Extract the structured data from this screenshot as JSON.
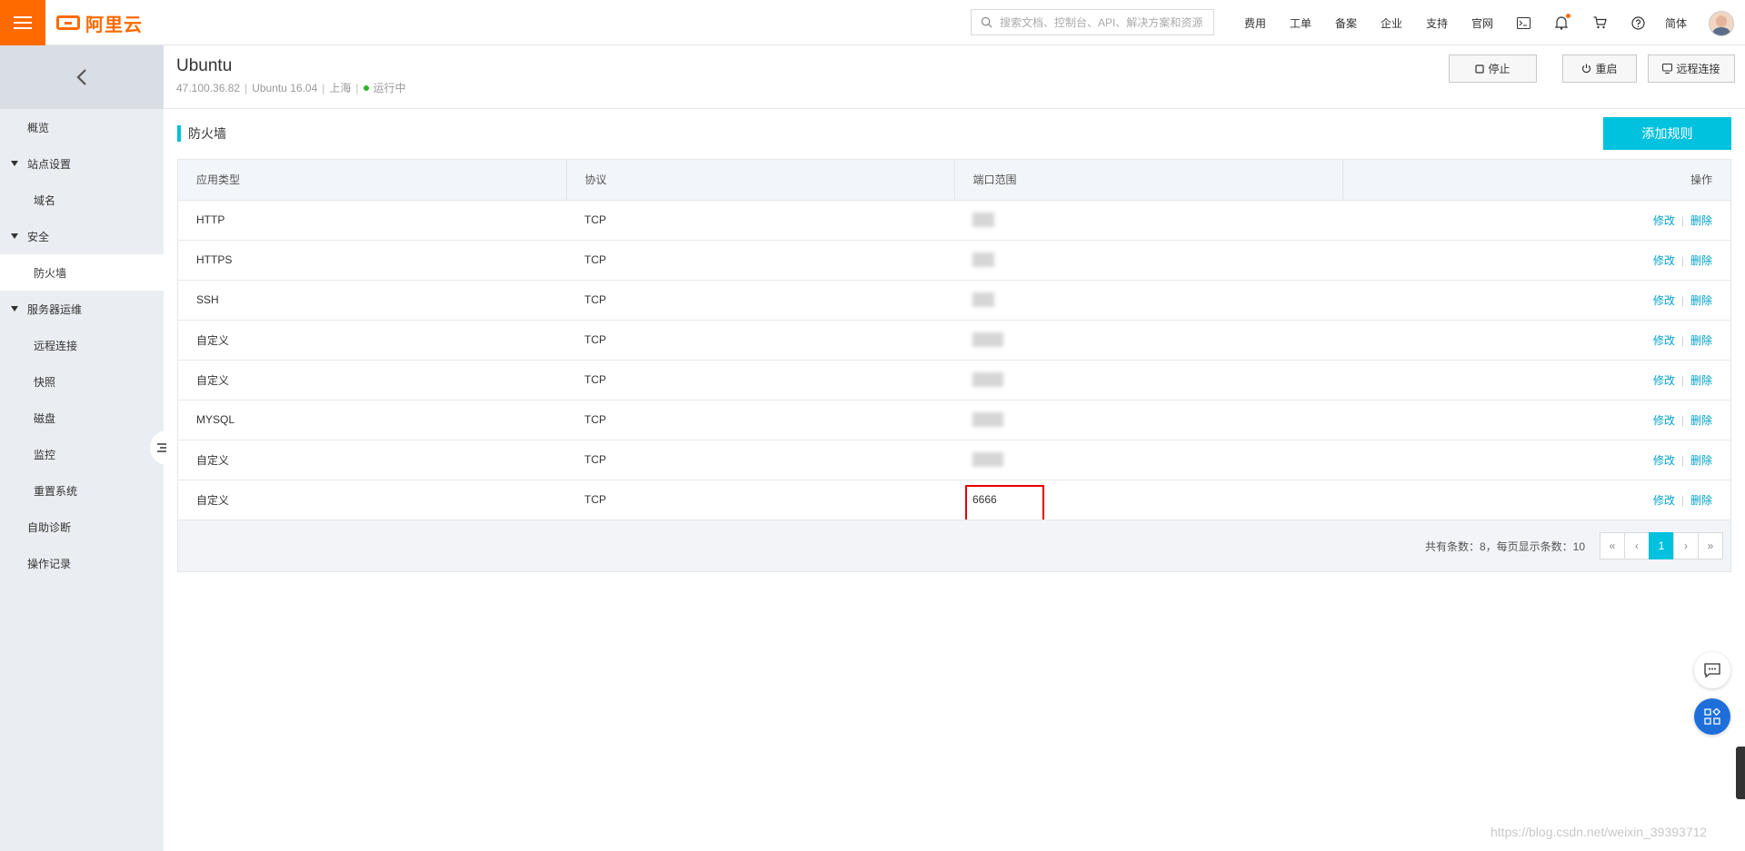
{
  "brand": {
    "logo_text": "阿里云"
  },
  "search": {
    "placeholder": "搜索文档、控制台、API、解决方案和资源"
  },
  "top_nav": {
    "links": [
      "费用",
      "工单",
      "备案",
      "企业",
      "支持",
      "官网"
    ],
    "language": "简体"
  },
  "sidebar": {
    "items": [
      {
        "label": "概览",
        "type": "top"
      },
      {
        "label": "站点设置",
        "type": "group"
      },
      {
        "label": "域名",
        "type": "sub"
      },
      {
        "label": "安全",
        "type": "group"
      },
      {
        "label": "防火墙",
        "type": "sub",
        "active": true
      },
      {
        "label": "服务器运维",
        "type": "group"
      },
      {
        "label": "远程连接",
        "type": "sub"
      },
      {
        "label": "快照",
        "type": "sub"
      },
      {
        "label": "磁盘",
        "type": "sub"
      },
      {
        "label": "监控",
        "type": "sub"
      },
      {
        "label": "重置系统",
        "type": "sub"
      },
      {
        "label": "自助诊断",
        "type": "top"
      },
      {
        "label": "操作记录",
        "type": "top"
      }
    ]
  },
  "instance": {
    "name": "Ubuntu",
    "ip": "47.100.36.82",
    "os": "Ubuntu 16.04",
    "region": "上海",
    "status": "运行中",
    "actions": {
      "stop": "停止",
      "restart": "重启",
      "remote": "远程连接"
    }
  },
  "firewall": {
    "title": "防火墙",
    "add_button": "添加规则",
    "columns": [
      "应用类型",
      "协议",
      "端口范围",
      "操作"
    ],
    "rows": [
      {
        "type": "HTTP",
        "protocol": "TCP",
        "port": ""
      },
      {
        "type": "HTTPS",
        "protocol": "TCP",
        "port": ""
      },
      {
        "type": "SSH",
        "protocol": "TCP",
        "port": ""
      },
      {
        "type": "自定义",
        "protocol": "TCP",
        "port": ""
      },
      {
        "type": "自定义",
        "protocol": "TCP",
        "port": ""
      },
      {
        "type": "MYSQL",
        "protocol": "TCP",
        "port": ""
      },
      {
        "type": "自定义",
        "protocol": "TCP",
        "port": ""
      },
      {
        "type": "自定义",
        "protocol": "TCP",
        "port": "6666"
      }
    ],
    "op_edit": "修改",
    "op_delete": "删除",
    "pager": {
      "info": "共有条数：8，每页显示条数：10",
      "first": "«",
      "prev": "‹",
      "current": "1",
      "next": "›",
      "last": "»"
    }
  },
  "watermark": "https://blog.csdn.net/weixin_39393712",
  "colors": {
    "brand": "#ff6a00",
    "accent": "#00c1de",
    "link": "#00a2ca",
    "highlight_box": "#e60000",
    "status_running": "#2cb52c"
  }
}
